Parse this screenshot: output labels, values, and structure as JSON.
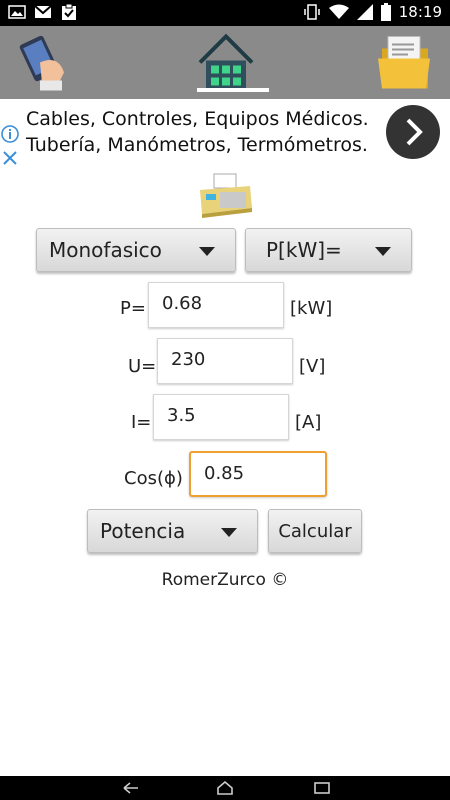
{
  "status_bar": {
    "time": "18:19",
    "icons": [
      "image-icon",
      "gmail-icon",
      "clipboard-icon",
      "vibrate-icon",
      "wifi-icon",
      "signal-icon",
      "battery-icon"
    ]
  },
  "toolbar": {
    "left_icon": "hand-phone-icon",
    "center_icon": "home-icon",
    "right_icon": "folder-icon"
  },
  "ad": {
    "line1": "Cables, Controles, Equipos Médicos.",
    "line2": "Tubería, Manómetros, Termómetros."
  },
  "form": {
    "system_select": "Monofasico",
    "mode_select": "P[kW]=",
    "p_label": "P=",
    "p_value": "0.68",
    "p_unit": "[kW]",
    "u_label": "U=",
    "u_value": "230",
    "u_unit": "[V]",
    "i_label": "I=",
    "i_value": "3.5",
    "i_unit": "[A]",
    "cos_label": "Cos(ϕ)",
    "cos_value": "0.85",
    "calc_select": "Potencia",
    "calc_button": "Calcular"
  },
  "footer": {
    "copyright": "RomerZurco ©"
  },
  "colors": {
    "toolbar": "#8a8a8a",
    "focus": "#f0a030",
    "ad_button": "#333333"
  }
}
